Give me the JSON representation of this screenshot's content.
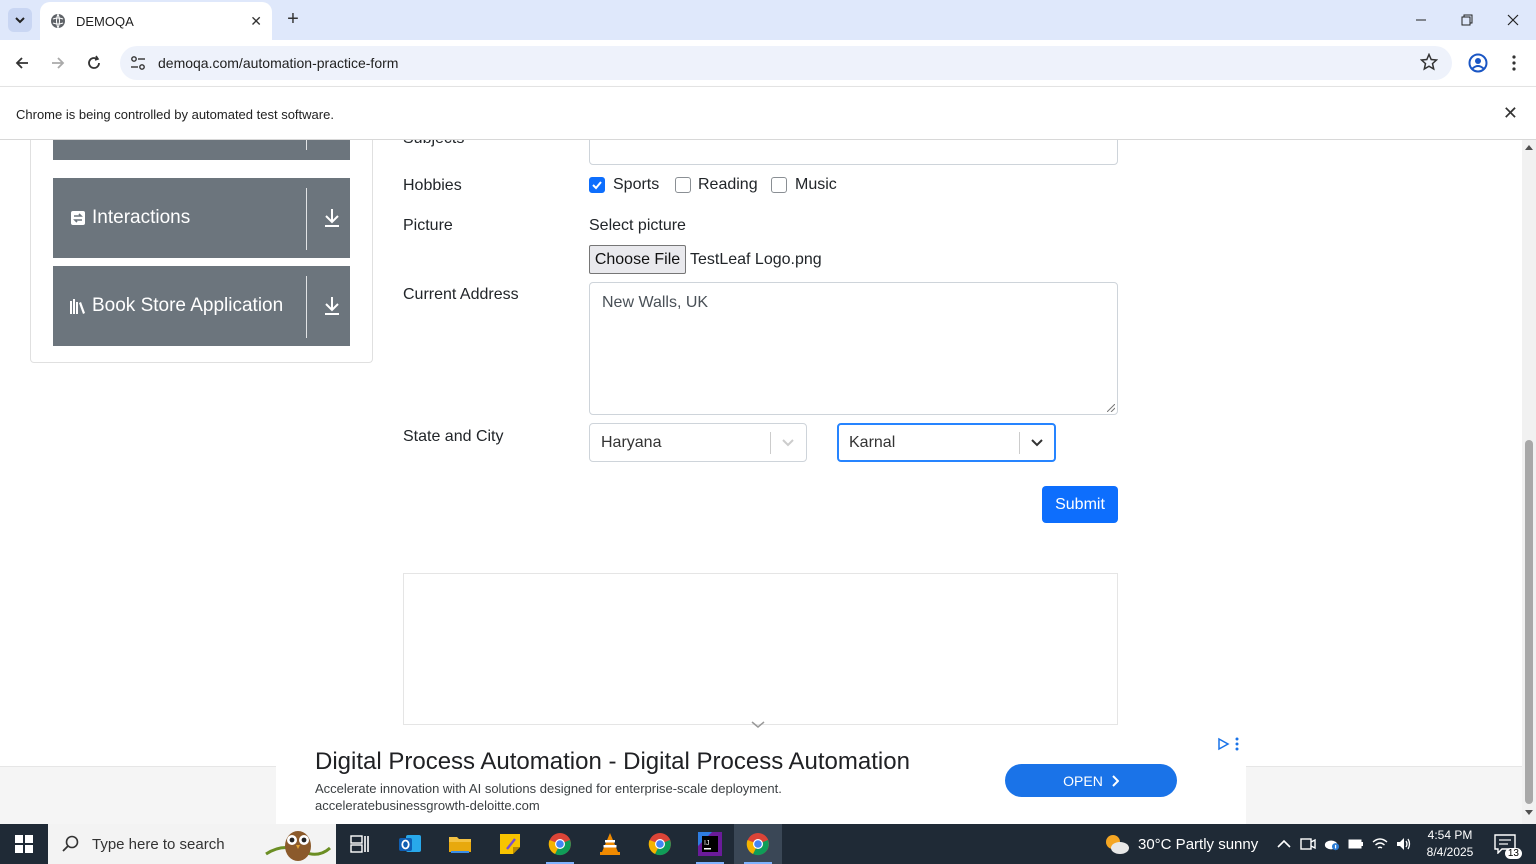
{
  "browser": {
    "tab_title": "DEMOQA",
    "url": "demoqa.com/automation-practice-form",
    "infobar_message": "Chrome is being controlled by automated test software."
  },
  "sidebar": {
    "items": [
      {
        "label": "Interactions",
        "icon": "interactions-icon"
      },
      {
        "label": "Book Store Application",
        "icon": "book-store-icon"
      }
    ]
  },
  "form": {
    "subjects_label": "Subjects",
    "hobbies_label": "Hobbies",
    "hobbies": [
      {
        "label": "Sports",
        "checked": true
      },
      {
        "label": "Reading",
        "checked": false
      },
      {
        "label": "Music",
        "checked": false
      }
    ],
    "picture_label": "Picture",
    "select_picture": "Select picture",
    "choose_file": "Choose File",
    "file_name": "TestLeaf Logo.png",
    "address_label": "Current Address",
    "address_value": "New Walls, UK",
    "state_city_label": "State and City",
    "state_value": "Haryana",
    "city_value": "Karnal",
    "submit_label": "Submit"
  },
  "ad": {
    "headline": "Digital Process Automation - Digital Process Automation",
    "description": "Accelerate innovation with AI solutions designed for enterprise-scale deployment.",
    "display_url": "acceleratebusinessgrowth-deloitte.com",
    "cta": "OPEN"
  },
  "taskbar": {
    "search_placeholder": "Type here to search",
    "weather": "30°C  Partly sunny",
    "time": "4:54 PM",
    "date": "8/4/2025",
    "notifications": "13"
  },
  "colors": {
    "accent": "#0d6efd",
    "sidebar_item": "#6c757d",
    "taskbar": "#1f2a36"
  }
}
